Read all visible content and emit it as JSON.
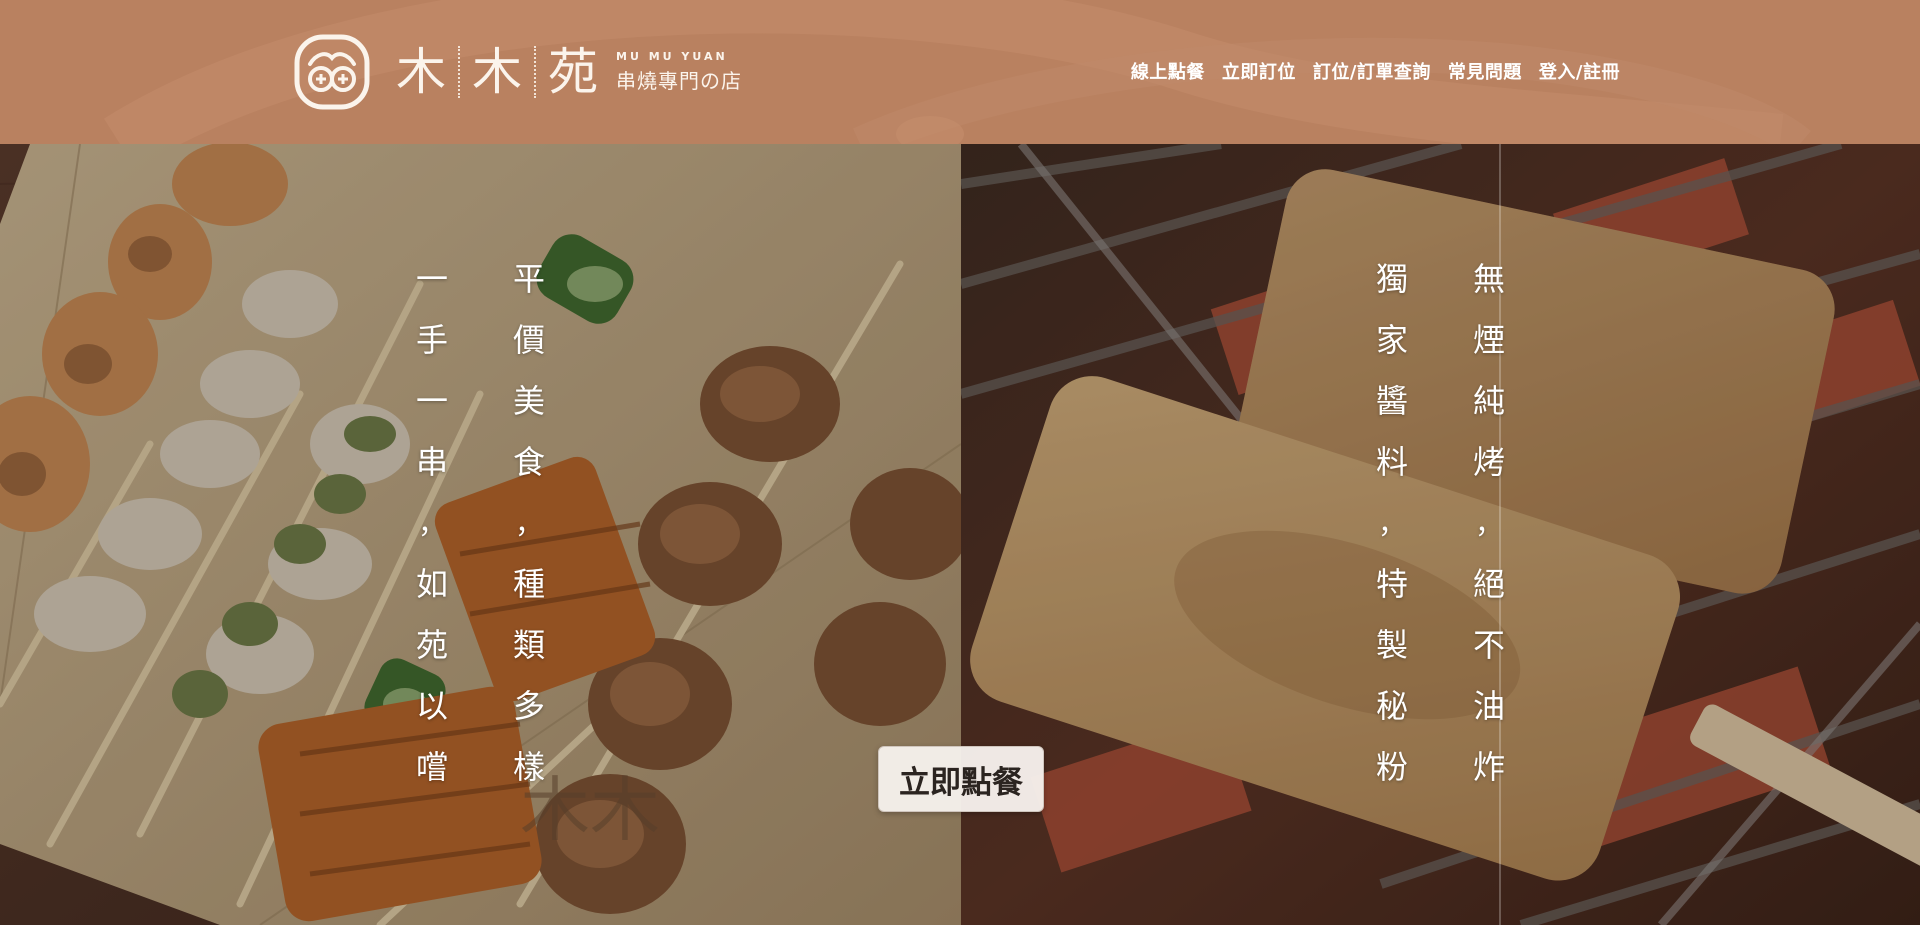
{
  "brand": {
    "name_chars": [
      "木",
      "木",
      "苑"
    ],
    "name_en": "MU MU YUAN",
    "tagline": "串燒專門の店",
    "colors": {
      "header_bg": "#b98160",
      "header_text": "#ffffff"
    }
  },
  "nav": {
    "items": [
      {
        "label": "線上點餐"
      },
      {
        "label": "立即訂位"
      },
      {
        "label": "訂位/訂單查詢"
      },
      {
        "label": "常見問題"
      },
      {
        "label": "登入/註冊"
      }
    ]
  },
  "hero": {
    "left": {
      "col1": [
        "一",
        "手",
        "一",
        "串",
        "，",
        "如",
        "苑",
        "以",
        "嚐"
      ],
      "col2": [
        "平",
        "價",
        "美",
        "食",
        "，",
        "種",
        "類",
        "多",
        "樣"
      ]
    },
    "right": {
      "col1": [
        "獨",
        "家",
        "醬",
        "料",
        "，",
        "特",
        "製",
        "秘",
        "粉"
      ],
      "col2": [
        "無",
        "煙",
        "純",
        "烤",
        "，",
        "絕",
        "不",
        "油",
        "炸"
      ]
    },
    "cta_label": "立即點餐"
  }
}
